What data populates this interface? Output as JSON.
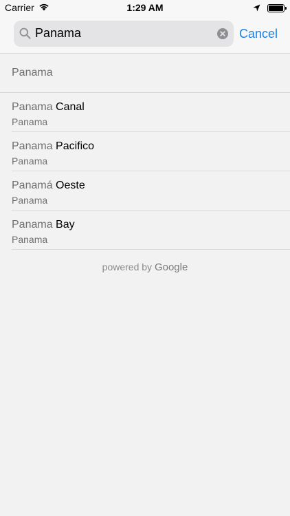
{
  "status_bar": {
    "carrier": "Carrier",
    "time": "1:29 AM",
    "battery_level": 1.0
  },
  "search": {
    "query": "Panama",
    "cancel_label": "Cancel"
  },
  "query_suggestion": "Panama",
  "results": [
    {
      "match": "Panama",
      "rest": " Canal",
      "secondary": "Panama"
    },
    {
      "match": "Panama",
      "rest": " Pacifico",
      "secondary": "Panama"
    },
    {
      "match": "Panamá",
      "rest": " Oeste",
      "secondary": "Panama"
    },
    {
      "match": "Panama",
      "rest": " Bay",
      "secondary": "Panama"
    }
  ],
  "attribution": {
    "prefix": "powered by",
    "brand": "Google"
  },
  "colors": {
    "accent": "#1a82e6",
    "background": "#f2f2f2"
  }
}
